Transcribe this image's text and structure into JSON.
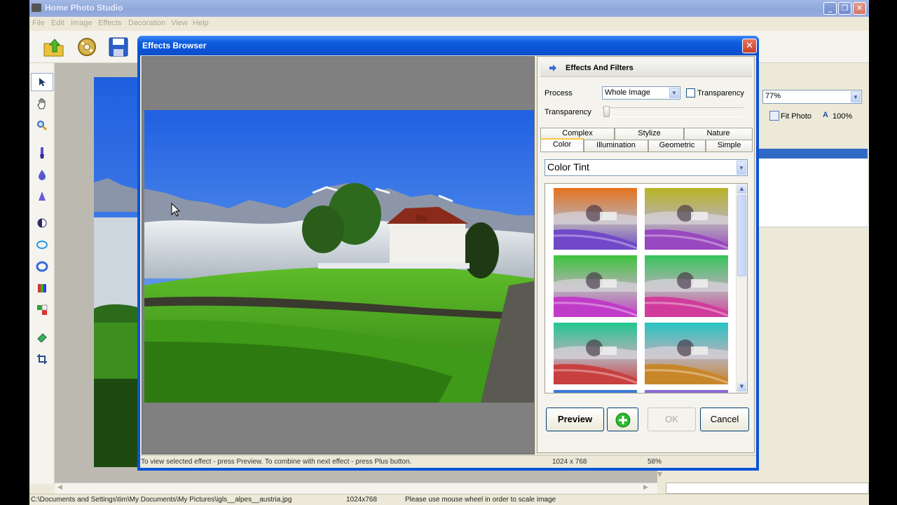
{
  "app": {
    "title": "Home Photo Studio",
    "menu": [
      "File",
      "Edit",
      "Image",
      "Effects",
      "Decoration",
      "View",
      "Help"
    ]
  },
  "right_panel": {
    "zoom_value": "77%",
    "fit_photo_label": "Fit Photo",
    "hundred_label": "100%"
  },
  "statusbar": {
    "path": "C:\\Documents and Settings\\tim\\My Documents\\My Pictures\\igls__alpes__austria.jpg",
    "dimensions": "1024x768",
    "hint": "Please use mouse wheel in order to scale image"
  },
  "dialog": {
    "title": "Effects Browser",
    "close_label": "✕",
    "panel_title": "Effects And Filters",
    "process_label": "Process",
    "process_value": "Whole Image",
    "transparency_checkbox_label": "Transparency",
    "transparency_slider_label": "Transparency",
    "transparency_level": 0,
    "tabs_row1": [
      "Complex",
      "Stylize",
      "Nature"
    ],
    "tabs_row2": [
      "Color",
      "Illumination",
      "Geometric",
      "Simple"
    ],
    "active_tab": "Color",
    "effect_select_value": "Color Tint",
    "thumbnails": [
      {
        "name": "orange-violet-tint",
        "top_color": "#e6721c",
        "bottom_color": "#7048c8"
      },
      {
        "name": "yellow-purple-tint",
        "top_color": "#b8b422",
        "bottom_color": "#9848c0"
      },
      {
        "name": "green-magenta-tint",
        "top_color": "#3cc43c",
        "bottom_color": "#c03cc8"
      },
      {
        "name": "green-pink-tint",
        "top_color": "#34c45a",
        "bottom_color": "#d03c9c"
      },
      {
        "name": "teal-red-tint",
        "top_color": "#22c690",
        "bottom_color": "#c84040"
      },
      {
        "name": "cyan-orange-tint",
        "top_color": "#28c4c4",
        "bottom_color": "#c8862a"
      }
    ],
    "buttons": {
      "preview": "Preview",
      "ok": "OK",
      "cancel": "Cancel"
    },
    "status": {
      "hint": "To view selected effect - press Preview. To combine with next effect - press Plus button.",
      "dimensions": "1024 x 768",
      "zoom": "58%"
    }
  },
  "icons": {
    "toolbar": [
      "open-folder-icon",
      "browse-disc-icon",
      "save-disk-icon"
    ],
    "tools": [
      "pointer-icon",
      "hand-icon",
      "zoom-icon",
      "brush-icon",
      "drop-icon",
      "cone-icon",
      "contrast-icon",
      "lasso-ellipse-icon",
      "ring-icon",
      "color-bars-icon",
      "color-blocks-icon",
      "eraser-icon",
      "crop-icon"
    ]
  },
  "colors": {
    "dialog_title": "#0a52d6",
    "selection": "#316ac5",
    "tab_highlight": "#ffc73c"
  }
}
